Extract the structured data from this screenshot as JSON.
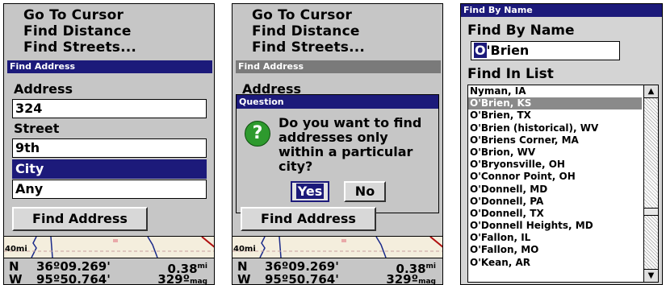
{
  "screen1": {
    "menu": [
      "Go To Cursor",
      "Find Distance",
      "Find Streets..."
    ],
    "title": "Find Address",
    "address_label": "Address",
    "address_value": "324",
    "street_label": "Street",
    "street_value": "9th",
    "city_label": "City",
    "city_value": "Any",
    "button": "Find Address",
    "map_scale": "40mi",
    "nav": {
      "lat_dir": "N",
      "lat": "36º09.269'",
      "dist": "0.38",
      "dist_unit": "mi",
      "lon_dir": "W",
      "lon": "95º50.764'",
      "heading": "329º",
      "heading_unit": "mag"
    }
  },
  "screen2": {
    "menu": [
      "Go To Cursor",
      "Find Distance",
      "Find Streets..."
    ],
    "title": "Find Address",
    "partial_label": "Address",
    "dialog": {
      "title": "Question",
      "lines": [
        "Do you want to find",
        "addresses only",
        "within a particular",
        "city?"
      ],
      "yes": "Yes",
      "no": "No"
    },
    "button": "Find Address",
    "map_scale": "40mi",
    "nav": {
      "lat_dir": "N",
      "lat": "36º09.269'",
      "dist": "0.38",
      "dist_unit": "mi",
      "lon_dir": "W",
      "lon": "95º50.764'",
      "heading": "329º",
      "heading_unit": "mag"
    }
  },
  "screen3": {
    "title": "Find By Name",
    "heading": "Find By Name",
    "input_cursor": "O",
    "input_rest": "'Brien",
    "list_label": "Find In List",
    "items": [
      "Nyman, IA",
      "O'Brien, KS",
      "O'Brien, TX",
      "O'Brien (historical), WV",
      "O'Briens Corner, MA",
      "O'Brion, WV",
      "O'Bryonsville, OH",
      "O'Connor Point, OH",
      "O'Donnell, MD",
      "O'Donnell, PA",
      "O'Donnell, TX",
      "O'Donnell Heights, MD",
      "O'Fallon, IL",
      "O'Fallon, MO",
      "O'Kean, AR"
    ],
    "selected_index": 1
  },
  "colors": {
    "title_bar": "#1c1a7a",
    "screen_bg": "#c6c6c6",
    "selection": "#8a8a8a"
  }
}
